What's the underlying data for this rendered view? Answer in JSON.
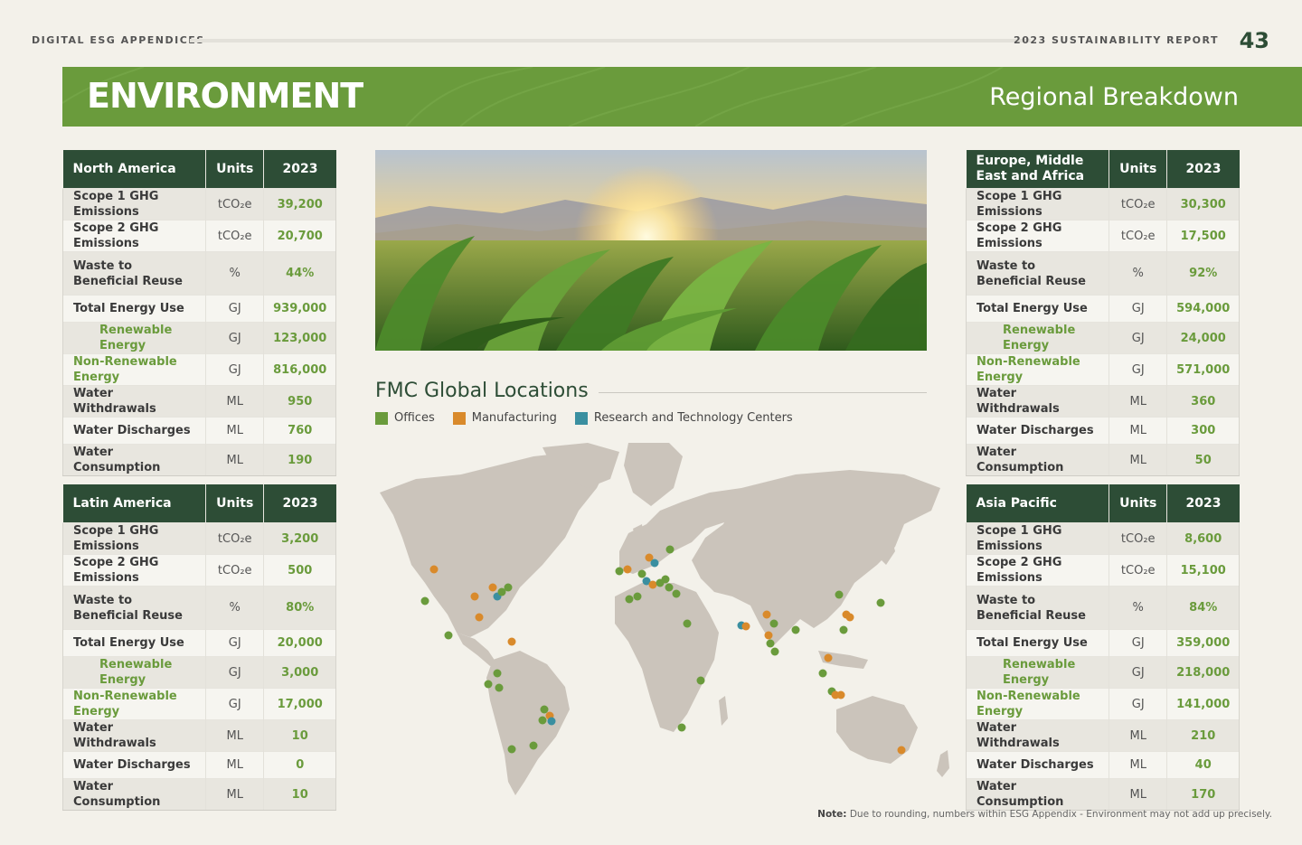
{
  "header": {
    "left": "DIGITAL ESG APPENDICES",
    "right": "2023 SUSTAINABILITY REPORT",
    "page": "43"
  },
  "banner": {
    "title": "ENVIRONMENT",
    "subtitle": "Regional Breakdown"
  },
  "columns": {
    "units": "Units",
    "year": "2023"
  },
  "regions": [
    {
      "name": "North America",
      "rows": [
        [
          "Scope 1 GHG Emissions",
          "tCO₂e",
          "39,200"
        ],
        [
          "Scope 2 GHG Emissions",
          "tCO₂e",
          "20,700"
        ],
        [
          "Waste to\nBeneficial Reuse",
          "%",
          "44%"
        ],
        [
          "Total Energy Use",
          "GJ",
          "939,000"
        ],
        [
          "Renewable Energy",
          "GJ",
          "123,000"
        ],
        [
          "Non-Renewable Energy",
          "GJ",
          "816,000"
        ],
        [
          "Water Withdrawals",
          "ML",
          "950"
        ],
        [
          "Water Discharges",
          "ML",
          "760"
        ],
        [
          "Water Consumption",
          "ML",
          "190"
        ]
      ]
    },
    {
      "name": "Latin America",
      "rows": [
        [
          "Scope 1 GHG Emissions",
          "tCO₂e",
          "3,200"
        ],
        [
          "Scope 2 GHG Emissions",
          "tCO₂e",
          "500"
        ],
        [
          "Waste to\nBeneficial Reuse",
          "%",
          "80%"
        ],
        [
          "Total Energy Use",
          "GJ",
          "20,000"
        ],
        [
          "Renewable Energy",
          "GJ",
          "3,000"
        ],
        [
          "Non-Renewable Energy",
          "GJ",
          "17,000"
        ],
        [
          "Water Withdrawals",
          "ML",
          "10"
        ],
        [
          "Water Discharges",
          "ML",
          "0"
        ],
        [
          "Water Consumption",
          "ML",
          "10"
        ]
      ]
    },
    {
      "name": "Europe, Middle East and Africa",
      "rows": [
        [
          "Scope 1 GHG Emissions",
          "tCO₂e",
          "30,300"
        ],
        [
          "Scope 2 GHG Emissions",
          "tCO₂e",
          "17,500"
        ],
        [
          "Waste to\nBeneficial Reuse",
          "%",
          "92%"
        ],
        [
          "Total Energy Use",
          "GJ",
          "594,000"
        ],
        [
          "Renewable Energy",
          "GJ",
          "24,000"
        ],
        [
          "Non-Renewable Energy",
          "GJ",
          "571,000"
        ],
        [
          "Water Withdrawals",
          "ML",
          "360"
        ],
        [
          "Water Discharges",
          "ML",
          "300"
        ],
        [
          "Water Consumption",
          "ML",
          "50"
        ]
      ]
    },
    {
      "name": "Asia Pacific",
      "rows": [
        [
          "Scope 1 GHG Emissions",
          "tCO₂e",
          "8,600"
        ],
        [
          "Scope 2 GHG Emissions",
          "tCO₂e",
          "15,100"
        ],
        [
          "Waste to\nBeneficial Reuse",
          "%",
          "84%"
        ],
        [
          "Total Energy Use",
          "GJ",
          "359,000"
        ],
        [
          "Renewable Energy",
          "GJ",
          "218,000"
        ],
        [
          "Non-Renewable Energy",
          "GJ",
          "141,000"
        ],
        [
          "Water Withdrawals",
          "ML",
          "210"
        ],
        [
          "Water Discharges",
          "ML",
          "40"
        ],
        [
          "Water Consumption",
          "ML",
          "170"
        ]
      ]
    }
  ],
  "map": {
    "title": "FMC Global Locations",
    "legend": [
      {
        "label": "Offices",
        "color": "#6a9b3c"
      },
      {
        "label": "Manufacturing",
        "color": "#d98a2b"
      },
      {
        "label": "Research and Technology Centers",
        "color": "#3a8fa0"
      }
    ]
  },
  "note": {
    "label": "Note:",
    "text": "Due to rounding, numbers within ESG Appendix - Environment may not add up precisely."
  }
}
